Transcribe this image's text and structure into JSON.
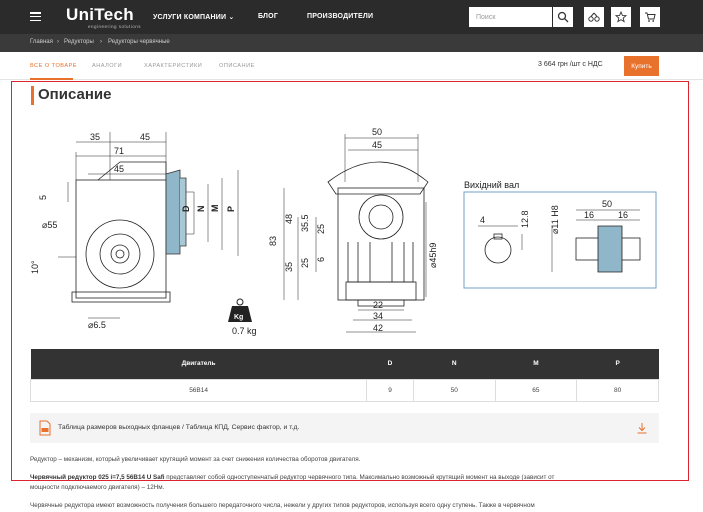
{
  "header": {
    "logo": "UniTech",
    "logo_sub": "engineering solutions",
    "nav": [
      {
        "label": "УСЛУГИ КОМПАНИИ"
      },
      {
        "label": "БЛОГ"
      },
      {
        "label": "ПРОИЗВОДИТЕЛИ"
      }
    ],
    "search_placeholder": "Поиск"
  },
  "breadcrumbs": [
    "Главная",
    "Редукторы",
    "Редукторы червячные"
  ],
  "tabs": [
    "ВСЕ О ТОВАРЕ",
    "АНАЛОГИ",
    "ХАРАКТЕРИСТИКИ",
    "ОПИСАНИЕ"
  ],
  "price": "3 664 грн /шт с НДС",
  "buy_label": "Купить",
  "section_title": "Описание",
  "drawing": {
    "left": {
      "d35": "35",
      "d45": "45",
      "d71": "71",
      "d45b": "45",
      "d5": "5",
      "d55": "⌀55",
      "d10": "10°",
      "d65": "⌀6.5",
      "D": "D",
      "N": "N",
      "M": "M",
      "P": "P"
    },
    "weight": "0.7 kg",
    "kg": "Kg",
    "middle": {
      "d50": "50",
      "d45": "45",
      "d83": "83",
      "d48": "48",
      "d35": "35",
      "d355": "35.5",
      "d25": "25",
      "d6": "6",
      "d22": "22",
      "d34": "34",
      "d42": "42",
      "d45h9": "⌀45h9"
    },
    "shaft": {
      "title": "Вихідний вал",
      "d4": "4",
      "d128": "12.8",
      "d11": "⌀11 H8",
      "d50": "50",
      "d16a": "16",
      "d16b": "16"
    }
  },
  "table": {
    "headers": [
      "Двигатель",
      "D",
      "N",
      "M",
      "P"
    ],
    "row": [
      "56B14",
      "9",
      "50",
      "65",
      "80"
    ]
  },
  "file_link": "Таблица размеров выходных фланцев / Таблица КПД, Сервис фактор, и т.д.",
  "paragraphs": {
    "p1": "Редуктор – механизм, который увеличивает крутящий момент за счет снижения количества оборотов двигателя.",
    "p2_bold": "Червячный редуктор 025 i=7,5 56B14 U Safi",
    "p2_rest": " представляет собой одноступенчатый редуктор червячного типа. Максимально возможный крутящий момент на выходе (зависит от",
    "p2_line2": "мощности подключаемого двигателя) – 12Нм.",
    "p3": "Червячные редуктора имеют возможность получения большего передаточного числа, нежели у других типов редукторов, используя всего одну ступень. Также в червячном"
  }
}
